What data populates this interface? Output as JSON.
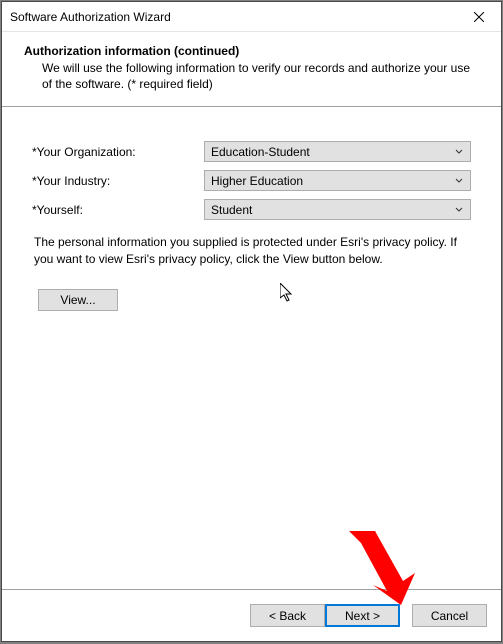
{
  "window": {
    "title": "Software Authorization Wizard"
  },
  "heading": {
    "title": "Authorization information (continued)",
    "description": "We will use the following information to verify our records and authorize your use of the software. (* required field)"
  },
  "form": {
    "organization_label": "*Your Organization:",
    "organization_value": "Education-Student",
    "industry_label": "*Your Industry:",
    "industry_value": "Higher Education",
    "yourself_label": "*Yourself:",
    "yourself_value": "Student"
  },
  "privacy": {
    "text": "The personal information you supplied is protected under Esri's privacy policy. If you want to view Esri's privacy policy, click the View button below.",
    "view_label": "View..."
  },
  "footer": {
    "back_label": "< Back",
    "next_label": "Next >",
    "cancel_label": "Cancel"
  }
}
